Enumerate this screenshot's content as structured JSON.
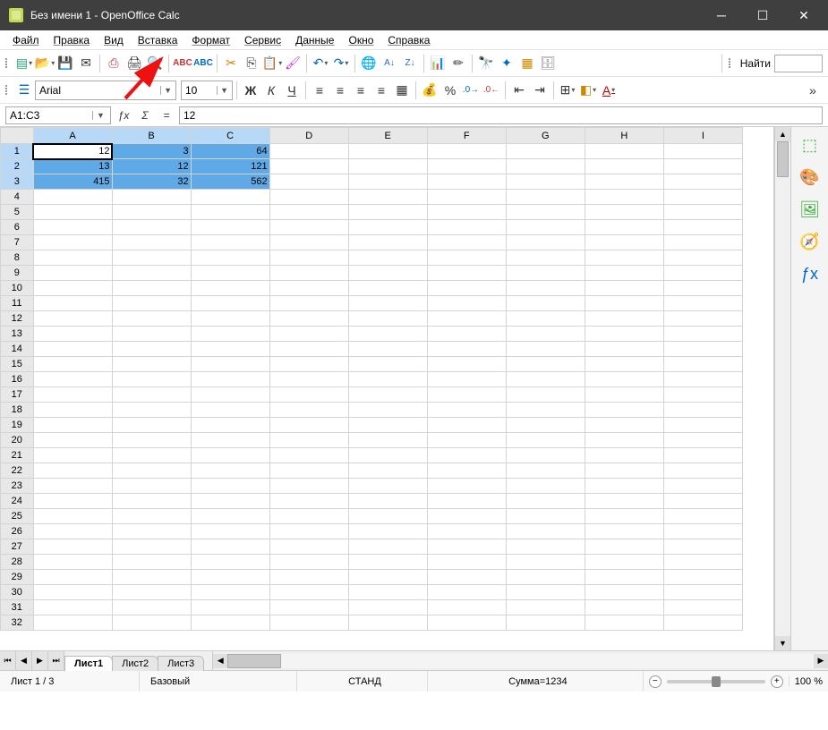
{
  "window": {
    "title": "Без имени 1 - OpenOffice Calc"
  },
  "menu": {
    "file": "Файл",
    "edit": "Правка",
    "view": "Вид",
    "insert": "Вставка",
    "format": "Формат",
    "tools": "Сервис",
    "data": "Данные",
    "window": "Окно",
    "help": "Справка"
  },
  "find": {
    "label": "Найти",
    "value": ""
  },
  "formatting": {
    "font_name": "Arial",
    "font_size": "10"
  },
  "formula": {
    "name_box": "A1:C3",
    "value": "12"
  },
  "columns": [
    "A",
    "B",
    "C",
    "D",
    "E",
    "F",
    "G",
    "H",
    "I"
  ],
  "rows_visible": 32,
  "selection": {
    "range": "A1:C3",
    "active": "A1"
  },
  "cells": {
    "A1": "12",
    "B1": "3",
    "C1": "64",
    "A2": "13",
    "B2": "12",
    "C2": "121",
    "A3": "415",
    "B3": "32",
    "C3": "562"
  },
  "sheets": {
    "tabs": [
      "Лист1",
      "Лист2",
      "Лист3"
    ],
    "active": 0
  },
  "status": {
    "sheet": "Лист 1 / 3",
    "style": "Базовый",
    "mode": "СТАНД",
    "sum_label": "Сумма=",
    "sum_value": "1234",
    "zoom": "100 %"
  }
}
